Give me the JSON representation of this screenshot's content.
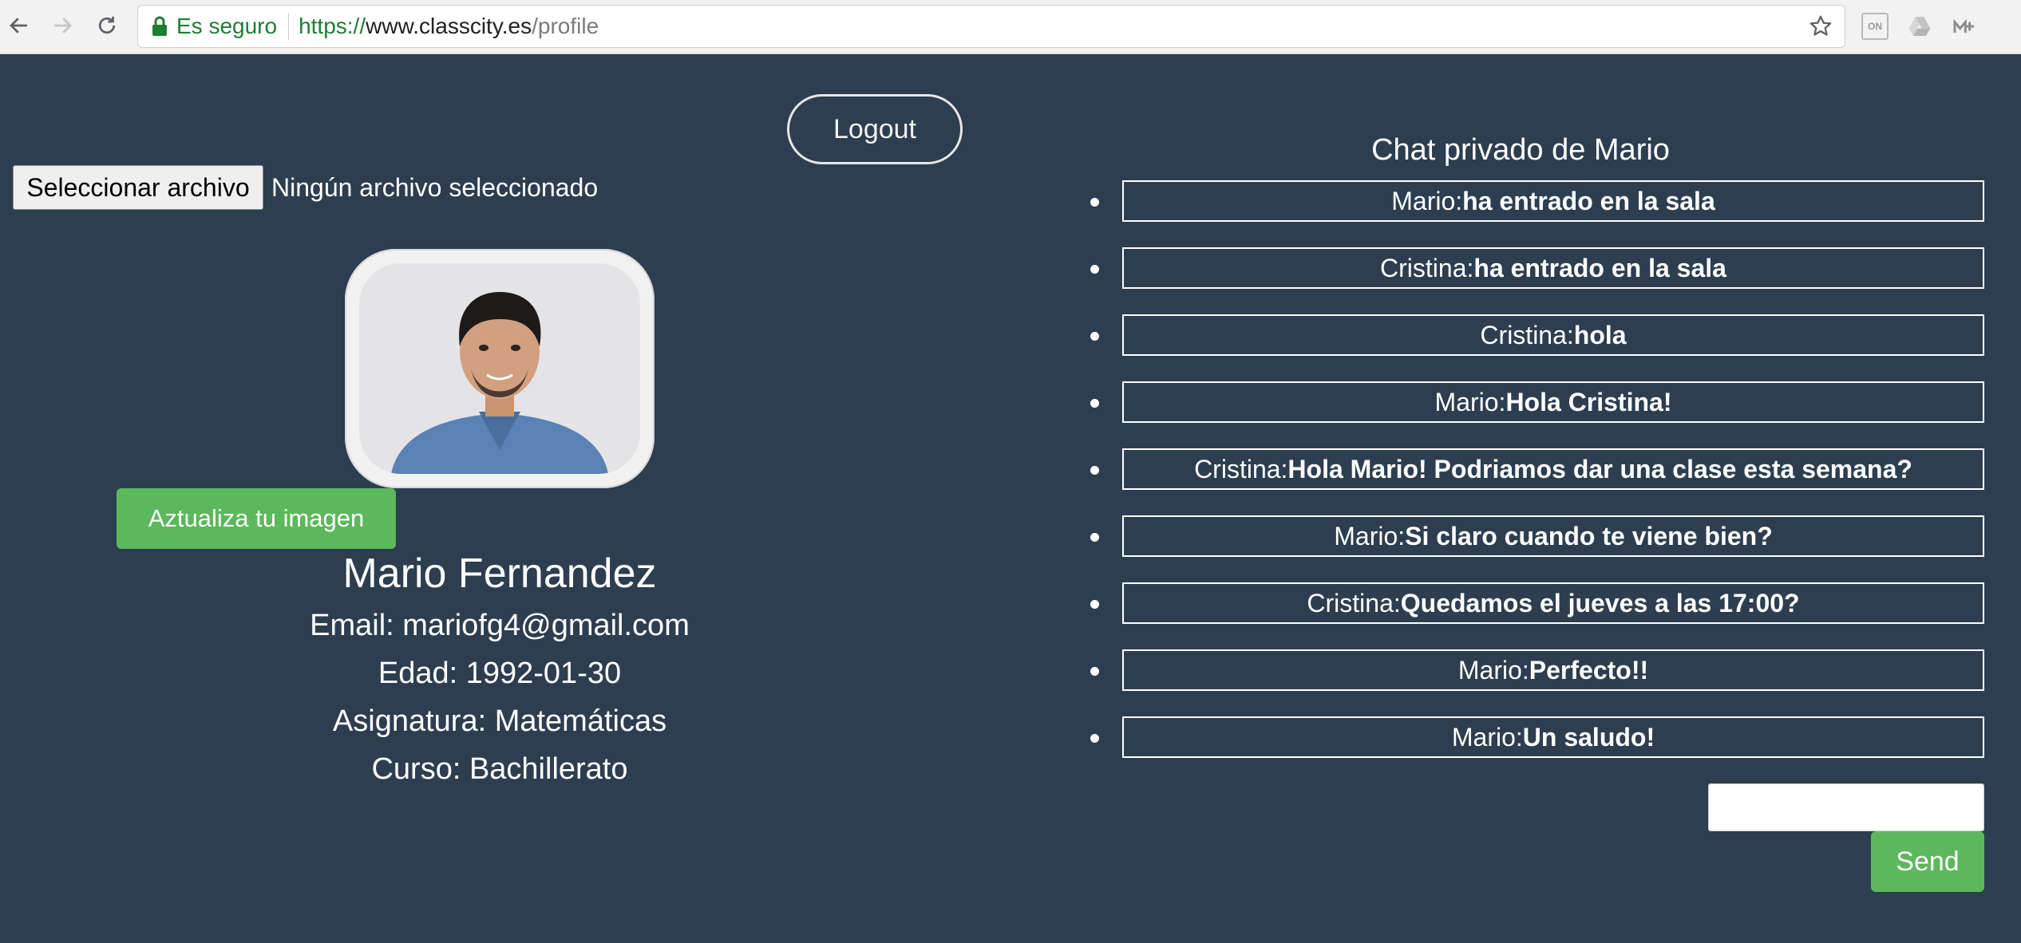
{
  "browser": {
    "secure_label": "Es seguro",
    "url_scheme": "https://",
    "url_host": "www.classcity.es",
    "url_path": "/profile",
    "extension_on_label": "ON"
  },
  "header": {
    "logout_label": "Logout"
  },
  "upload": {
    "button_label": "Seleccionar archivo",
    "status_text": "Ningún archivo seleccionado",
    "update_button_label": "Aztualiza tu imagen"
  },
  "profile": {
    "name": "Mario Fernandez",
    "email_line": "Email: mariofg4@gmail.com",
    "age_line": "Edad: 1992-01-30",
    "subject_line": "Asignatura: Matemáticas",
    "course_line": "Curso: Bachillerato"
  },
  "chat": {
    "title": "Chat privado de Mario",
    "messages": [
      {
        "user": "Mario:",
        "text": "ha entrado en la sala"
      },
      {
        "user": "Cristina:",
        "text": "ha entrado en la sala"
      },
      {
        "user": "Cristina:",
        "text": "hola"
      },
      {
        "user": "Mario:",
        "text": "Hola Cristina!"
      },
      {
        "user": "Cristina:",
        "text": "Hola Mario! Podriamos dar una clase esta semana?"
      },
      {
        "user": "Mario:",
        "text": "Si claro cuando te viene bien?"
      },
      {
        "user": "Cristina:",
        "text": "Quedamos el jueves a las 17:00?"
      },
      {
        "user": "Mario:",
        "text": "Perfecto!!"
      },
      {
        "user": "Mario:",
        "text": "Un saludo!"
      }
    ],
    "input_value": "",
    "send_label": "Send"
  },
  "colors": {
    "background": "#2c3e50",
    "accent_green": "#5cb85c",
    "secure_green": "#1e7e34"
  },
  "icons": [
    "back-arrow-icon",
    "forward-arrow-icon",
    "reload-icon",
    "lock-icon",
    "star-icon",
    "google-drive-icon",
    "extension-icon"
  ]
}
